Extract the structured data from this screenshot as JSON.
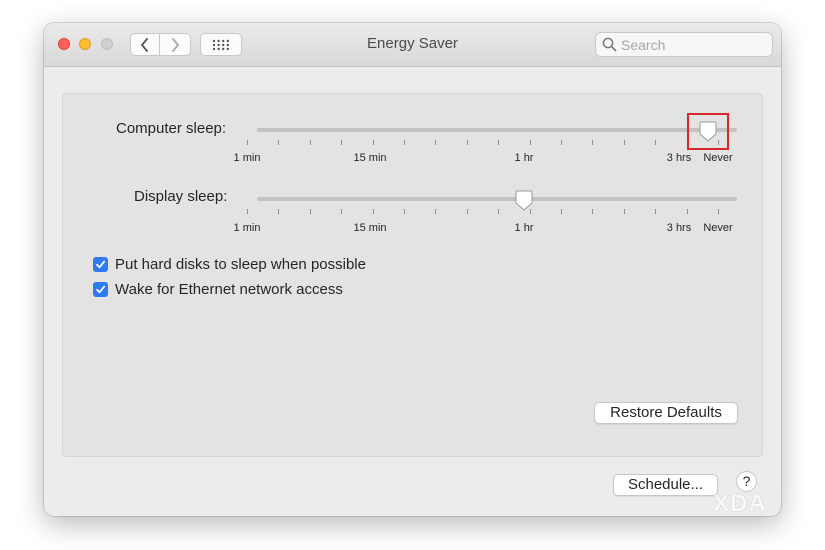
{
  "window": {
    "title": "Energy Saver",
    "traffic_lights": [
      "close",
      "minimize",
      "zoom-disabled"
    ],
    "nav": {
      "back_icon": "chevron-left-icon",
      "forward_icon": "chevron-right-icon",
      "grid_icon": "grid-icon"
    }
  },
  "search": {
    "placeholder": "Search",
    "icon": "search-icon"
  },
  "computer_sleep": {
    "label": "Computer sleep:",
    "tick_labels": [
      "1 min",
      "15 min",
      "1 hr",
      "3 hrs",
      "Never"
    ],
    "value": "Never",
    "highlighted": true
  },
  "display_sleep": {
    "label": "Display sleep:",
    "tick_labels": [
      "1 min",
      "15 min",
      "1 hr",
      "3 hrs",
      "Never"
    ],
    "value": "1 hr"
  },
  "options": [
    {
      "label": "Put hard disks to sleep when possible",
      "checked": true
    },
    {
      "label": "Wake for Ethernet network access",
      "checked": true
    }
  ],
  "buttons": {
    "restore_defaults": "Restore Defaults",
    "schedule": "Schedule...",
    "help": "?"
  },
  "watermark": "XDA",
  "colors": {
    "accent": "#2c7bf2",
    "highlight_box": "#d8272a"
  }
}
